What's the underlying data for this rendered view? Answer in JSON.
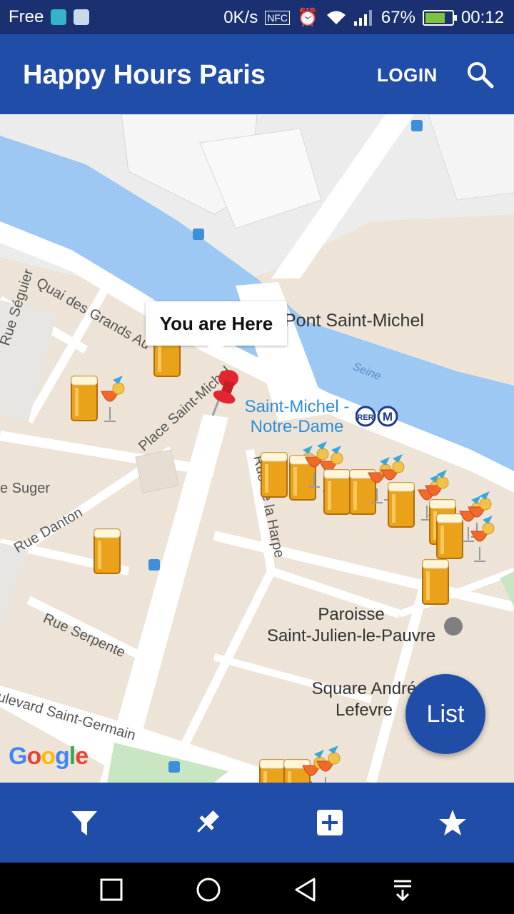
{
  "status_bar": {
    "carrier": "Free",
    "net_speed": "0K/s",
    "nfc": "NFC",
    "battery": "67%",
    "battery_level": 0.67,
    "time": "00:12"
  },
  "app_bar": {
    "title": "Happy Hours Paris",
    "login_label": "LOGIN",
    "search_icon": "search-icon"
  },
  "map": {
    "tooltip": "You are Here",
    "bridge_label": "Pont Saint-Michel",
    "river_label": "Seine",
    "metro": {
      "line1": "Saint-Michel -",
      "line2": "Notre-Dame",
      "rer": "RER",
      "m": "M"
    },
    "streets": {
      "quai": "Quai des Grands Au",
      "seguier": "Rue Séguier",
      "place": "Place Saint-Michel",
      "suger": "e Suger",
      "danton": "Rue Danton",
      "harpe": "Rue de la Harpe",
      "serpente": "Rue Serpente",
      "boulevard": "ulevard Saint-Germain"
    },
    "poi": {
      "paroisse1": "Paroisse",
      "paroisse2": "Saint-Julien-le-Pauvre",
      "square1": "Square André",
      "square2": "Lefevre"
    },
    "google_logo": "Google",
    "list_button": "List"
  },
  "bottom_nav": {
    "items": [
      {
        "icon": "filter-icon"
      },
      {
        "icon": "pushpin-icon"
      },
      {
        "icon": "add-box-icon"
      },
      {
        "icon": "star-icon"
      }
    ]
  },
  "system_nav": {
    "items": [
      "recent-apps-icon",
      "home-icon",
      "back-icon",
      "notifications-icon"
    ]
  },
  "colors": {
    "primary": "#1f4da8",
    "status_bar": "#1a3070",
    "water": "#9dc8f3",
    "map_land": "#ede4d7"
  }
}
